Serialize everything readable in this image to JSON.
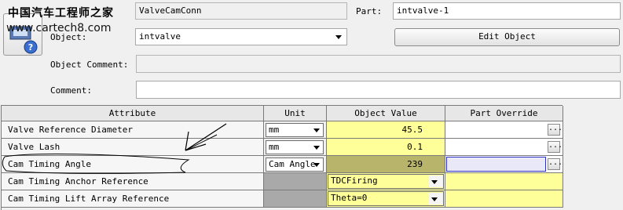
{
  "watermark": {
    "line1": "中国汽车工程师之家",
    "line2": "www.cartech8.com"
  },
  "form": {
    "template_value": "ValveCamConn",
    "part_label": "Part:",
    "part_value": "intvalve-1",
    "object_label": "Object:",
    "object_value": "intvalve",
    "edit_object_label": "Edit Object",
    "object_comment_label": "Object Comment:",
    "object_comment_value": "",
    "comment_label": "Comment:",
    "comment_value": ""
  },
  "table": {
    "headers": [
      "Attribute",
      "Unit",
      "Object Value",
      "Part Override"
    ],
    "rows": [
      {
        "attribute": "Valve Reference Diameter",
        "unit": "mm",
        "object_value": "45.5",
        "part_override": "",
        "kind": "number"
      },
      {
        "attribute": "Valve Lash",
        "unit": "mm",
        "object_value": "0.1",
        "part_override": "",
        "kind": "number"
      },
      {
        "attribute": "Cam Timing Angle",
        "unit": "Cam Angle",
        "object_value": "239",
        "part_override": "",
        "kind": "number",
        "selected": true
      },
      {
        "attribute": "Cam Timing Anchor Reference",
        "unit": "",
        "object_value": "TDCFiring",
        "part_override": "",
        "kind": "combo"
      },
      {
        "attribute": "Cam Timing Lift Array Reference",
        "unit": "",
        "object_value": "Theta=0",
        "part_override": "",
        "kind": "combo"
      }
    ]
  },
  "colors": {
    "value_bg": "#ffff99",
    "selected_value_bg": "#b8b46c",
    "selected_override_border": "#3030c0",
    "disabled_unit_bg": "#a9a9a9"
  }
}
